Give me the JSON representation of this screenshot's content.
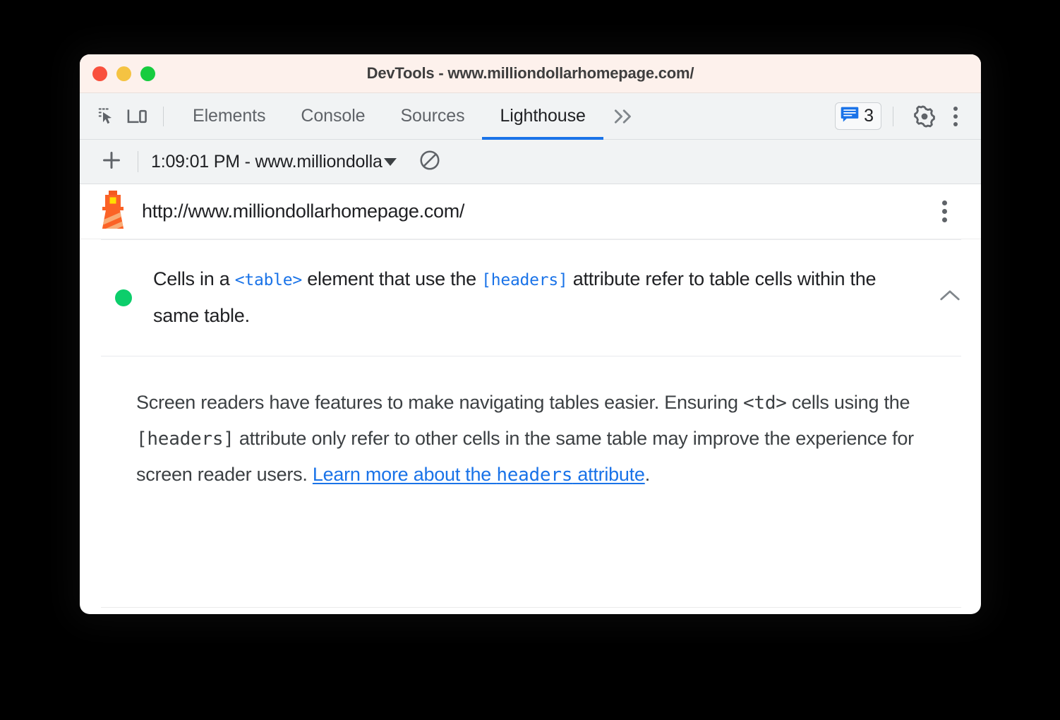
{
  "window": {
    "title": "DevTools - www.milliondollarhomepage.com/",
    "traffic_lights": [
      "close",
      "minimize",
      "zoom"
    ],
    "colors": {
      "titlebar_bg": "#fdf1ec",
      "accent_blue": "#1a73e8",
      "pass_green": "#0cce6b",
      "toolbar_bg": "#f1f3f4"
    }
  },
  "tabbar": {
    "inspect_icon": "inspect-element-icon",
    "device_icon": "device-toolbar-icon",
    "tabs": [
      {
        "label": "Elements",
        "active": false
      },
      {
        "label": "Console",
        "active": false
      },
      {
        "label": "Sources",
        "active": false
      },
      {
        "label": "Lighthouse",
        "active": true
      }
    ],
    "more_tabs_icon": "chevron-double-right-icon",
    "message_badge": {
      "icon": "message-bubble-icon",
      "count": "3"
    },
    "settings_icon": "gear-icon",
    "main_menu_icon": "kebab-menu-icon"
  },
  "toolbar": {
    "add_label": "+",
    "add_icon": "plus-icon",
    "report_selector": {
      "value": "1:09:01 PM - www.milliondolla",
      "caret_icon": "caret-down-icon"
    },
    "clear_icon": "clear-all-icon"
  },
  "url_row": {
    "brand_icon": "lighthouse-icon",
    "url": "http://www.milliondollarhomepage.com/",
    "menu_icon": "kebab-menu-icon"
  },
  "audit": {
    "status": "pass",
    "status_icon": "green-circle-icon",
    "title": {
      "part1": "Cells in a ",
      "code1": "<table>",
      "part2": " element that use the ",
      "code2": "[headers]",
      "part3": " attribute refer to table cells within the same table."
    },
    "collapse_icon": "chevron-up-icon",
    "description": {
      "part1": "Screen readers have features to make navigating tables easier. Ensuring ",
      "code1": "<td>",
      "part2": " cells using the ",
      "code2": "[headers]",
      "part3": " attribute only refer to other cells in the same table may improve the experience for screen reader users. ",
      "link": {
        "text_before": "Learn more about the ",
        "code": "headers",
        "text_after": " attribute"
      },
      "part4": "."
    }
  }
}
